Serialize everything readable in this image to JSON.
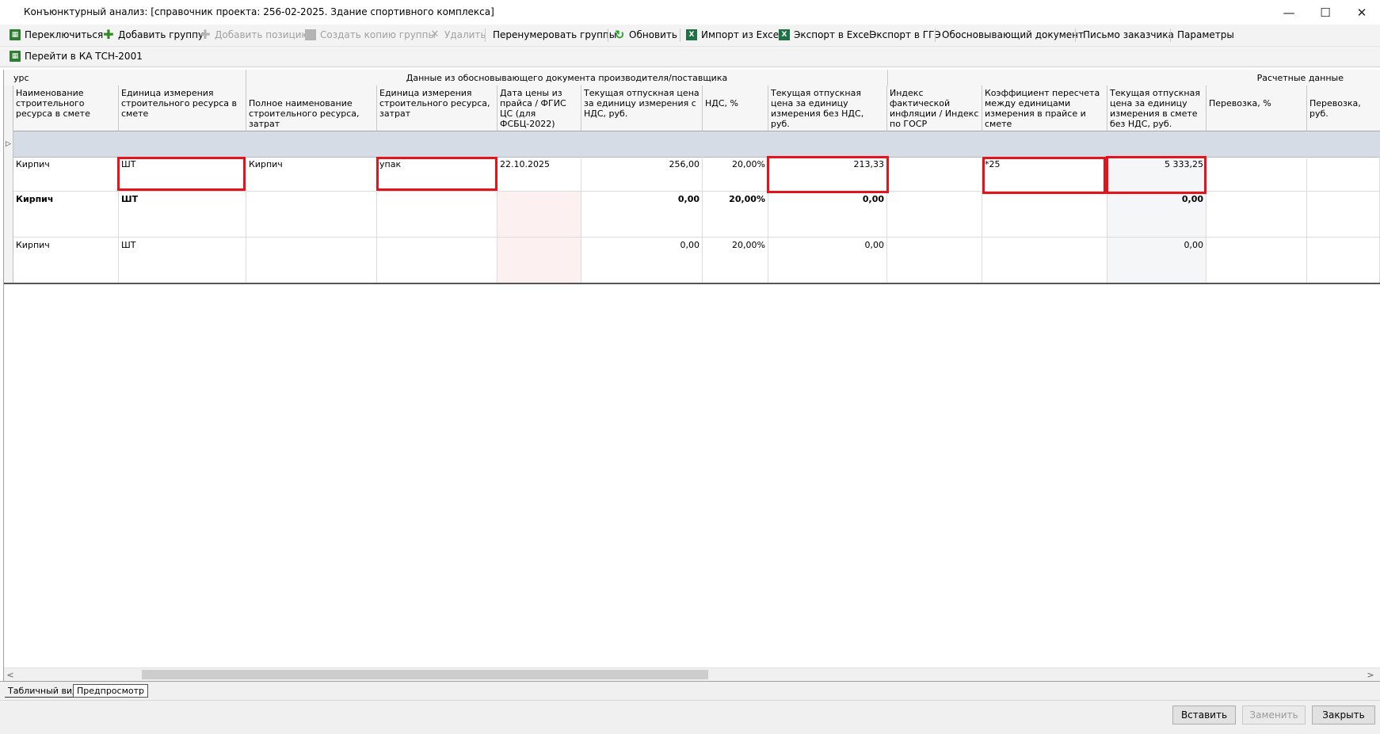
{
  "window": {
    "title": "Конъюнктурный анализ: [справочник проекта: 256-02-2025. Здание спортивного комплекса]",
    "minimize": "—",
    "maximize": "☐",
    "close": "✕"
  },
  "toolbar": {
    "switch": "Переключиться",
    "add_group": "Добавить группу",
    "add_position": "Добавить позицию",
    "copy_group": "Создать копию группы",
    "delete": "Удалить",
    "renumber": "Перенумеровать группы",
    "refresh": "Обновить",
    "import_excel": "Импорт из Excel",
    "export_excel": "Экспорт в Excel",
    "export_gge": "Экспорт в ГГЭ",
    "justify_doc": "Обосновывающий документ",
    "customer_letter": "Письмо заказчика",
    "params": "Параметры",
    "goto_ka": "Перейти в КА ТСН-2001"
  },
  "bands": {
    "resource": "урс",
    "supplier": "Данные из обосновывающего документа производителя/поставщика",
    "calc": "Расчетные данные"
  },
  "columns": [
    "Наименование строительного ресурса в смете",
    "Единица измерения строительного ресурса в смете",
    "Полное наименование строительного ресурса, затрат",
    "Единица измерения строительного ресурса, затрат",
    "Дата цены из прайса / ФГИС ЦС (для ФСБЦ-2022)",
    "Текущая отпускная цена за единицу измерения с НДС, руб.",
    "НДС, %",
    "Текущая отпускная цена за единицу измерения без НДС, руб.",
    "Индекс фактической инфляции /  Индекс по  ГОСР",
    "Коэффициент пересчета между единицами измерения в прайсе и смете",
    "Текущая отпускная цена за единицу измерения в смете без НДС, руб.",
    "Перевозка, %",
    "Перевозка, руб."
  ],
  "rows": [
    [
      "Кирпич",
      "ШТ",
      "Кирпич",
      "упак",
      "22.10.2025",
      "256,00",
      "20,00%",
      "213,33",
      "",
      "*25",
      "5 333,25",
      "",
      ""
    ],
    [
      "Кирпич",
      "ШТ",
      "",
      "",
      "",
      "0,00",
      "20,00%",
      "0,00",
      "",
      "",
      "0,00",
      "",
      ""
    ],
    [
      "Кирпич",
      "ШТ",
      "",
      "",
      "",
      "0,00",
      "20,00%",
      "0,00",
      "",
      "",
      "0,00",
      "",
      ""
    ]
  ],
  "tabs": {
    "table_view": "Табличный вид",
    "preview": "Предпросмотр"
  },
  "buttons": {
    "insert": "Вставить",
    "replace": "Заменить",
    "close": "Закрыть"
  },
  "colors": {
    "highlight": "#e3141c",
    "group_band": "#d5dce6",
    "pink_cell": "#fdf0f0"
  }
}
